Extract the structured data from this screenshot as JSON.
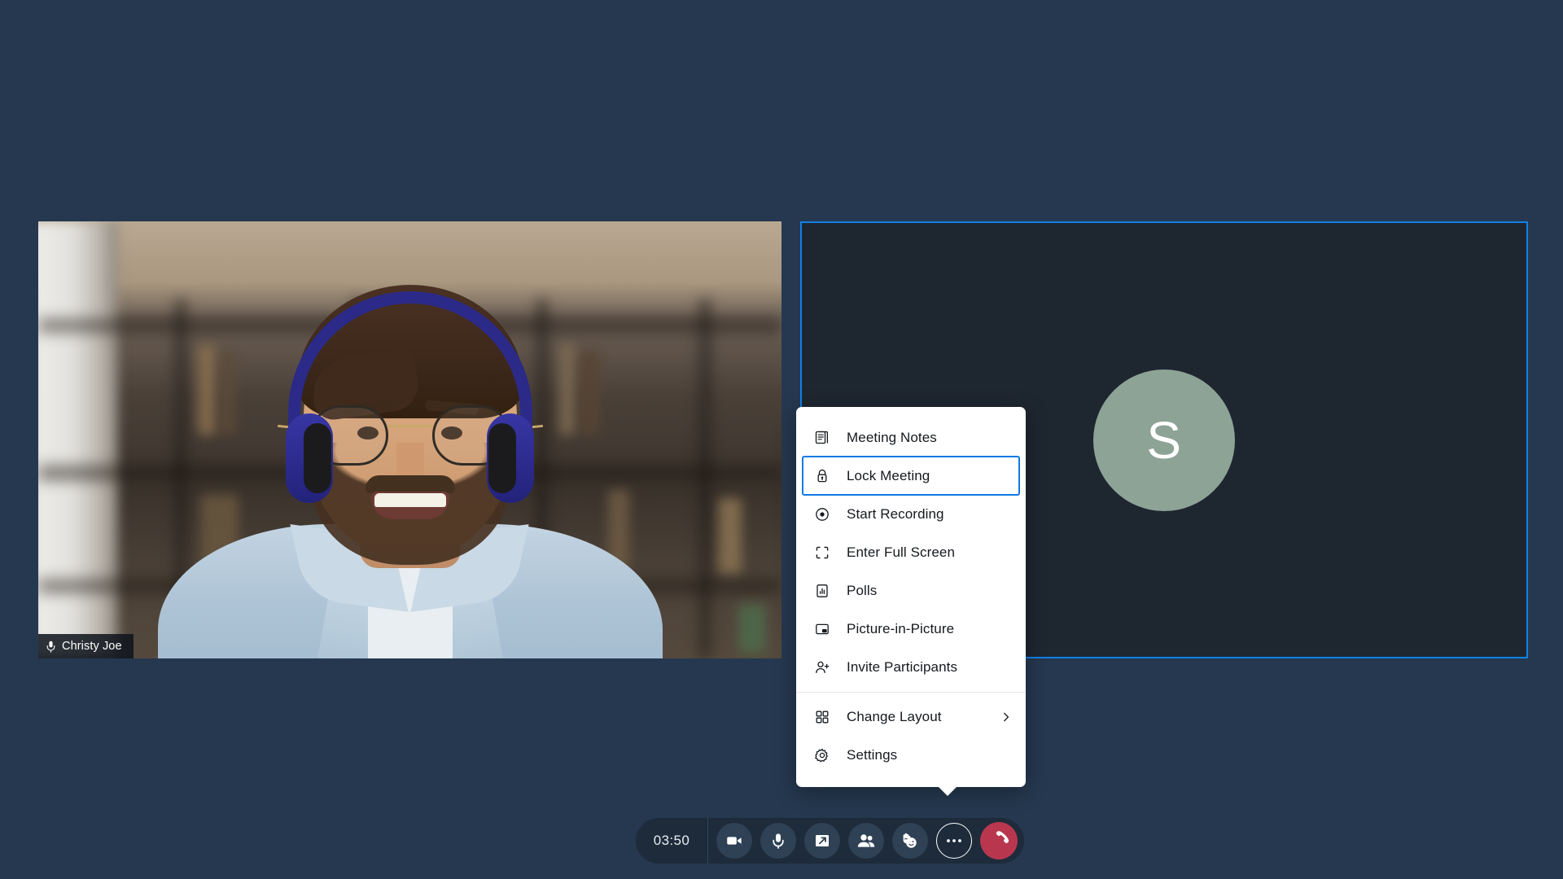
{
  "meeting": {
    "timer": "03:50",
    "background_color": "#25384f"
  },
  "tiles": [
    {
      "type": "video",
      "participant_name": "Christy Joe",
      "mic_icon": "microphone-icon",
      "active": false
    },
    {
      "type": "avatar",
      "initial": "S",
      "avatar_color": "#8da396",
      "active": true,
      "border_color": "#1281e8"
    }
  ],
  "context_menu": {
    "focused_item": "Lock Meeting",
    "focus_color": "#0f7ae5",
    "items": [
      {
        "label": "Meeting Notes",
        "icon": "notes-icon",
        "has_submenu": false,
        "focused": false
      },
      {
        "label": "Lock Meeting",
        "icon": "lock-icon",
        "has_submenu": false,
        "focused": true
      },
      {
        "label": "Start Recording",
        "icon": "record-icon",
        "has_submenu": false,
        "focused": false
      },
      {
        "label": "Enter Full Screen",
        "icon": "fullscreen-icon",
        "has_submenu": false,
        "focused": false
      },
      {
        "label": "Polls",
        "icon": "poll-chart-icon",
        "has_submenu": false,
        "focused": false
      },
      {
        "label": "Picture-in-Picture",
        "icon": "picture-in-picture-icon",
        "has_submenu": false,
        "focused": false
      },
      {
        "label": "Invite Participants",
        "icon": "person-add-icon",
        "has_submenu": false,
        "focused": false
      },
      {
        "label": "Change Layout",
        "icon": "grid-layout-icon",
        "has_submenu": true,
        "focused": false
      },
      {
        "label": "Settings",
        "icon": "gear-icon",
        "has_submenu": false,
        "focused": false
      }
    ],
    "separator_after_index": 6
  },
  "toolbar": {
    "timer": "03:50",
    "buttons": [
      {
        "name": "camera",
        "icon": "video-camera-icon",
        "label": "Camera",
        "state": "on",
        "style": "normal"
      },
      {
        "name": "microphone",
        "icon": "microphone-icon",
        "label": "Microphone",
        "state": "on",
        "style": "normal"
      },
      {
        "name": "share-screen",
        "icon": "share-screen-icon",
        "label": "Share Screen",
        "state": "off",
        "style": "normal"
      },
      {
        "name": "participants",
        "icon": "people-icon",
        "label": "Participants",
        "state": "off",
        "style": "normal"
      },
      {
        "name": "reactions",
        "icon": "raised-hand-smiley-icon",
        "label": "Reactions",
        "state": "off",
        "style": "normal"
      },
      {
        "name": "more-options",
        "icon": "ellipsis-icon",
        "label": "More Options",
        "state": "active",
        "style": "outlined"
      },
      {
        "name": "end-call",
        "icon": "phone-hangup-icon",
        "label": "End Call",
        "state": "off",
        "style": "danger"
      }
    ],
    "end_call_color": "#b8374f"
  }
}
